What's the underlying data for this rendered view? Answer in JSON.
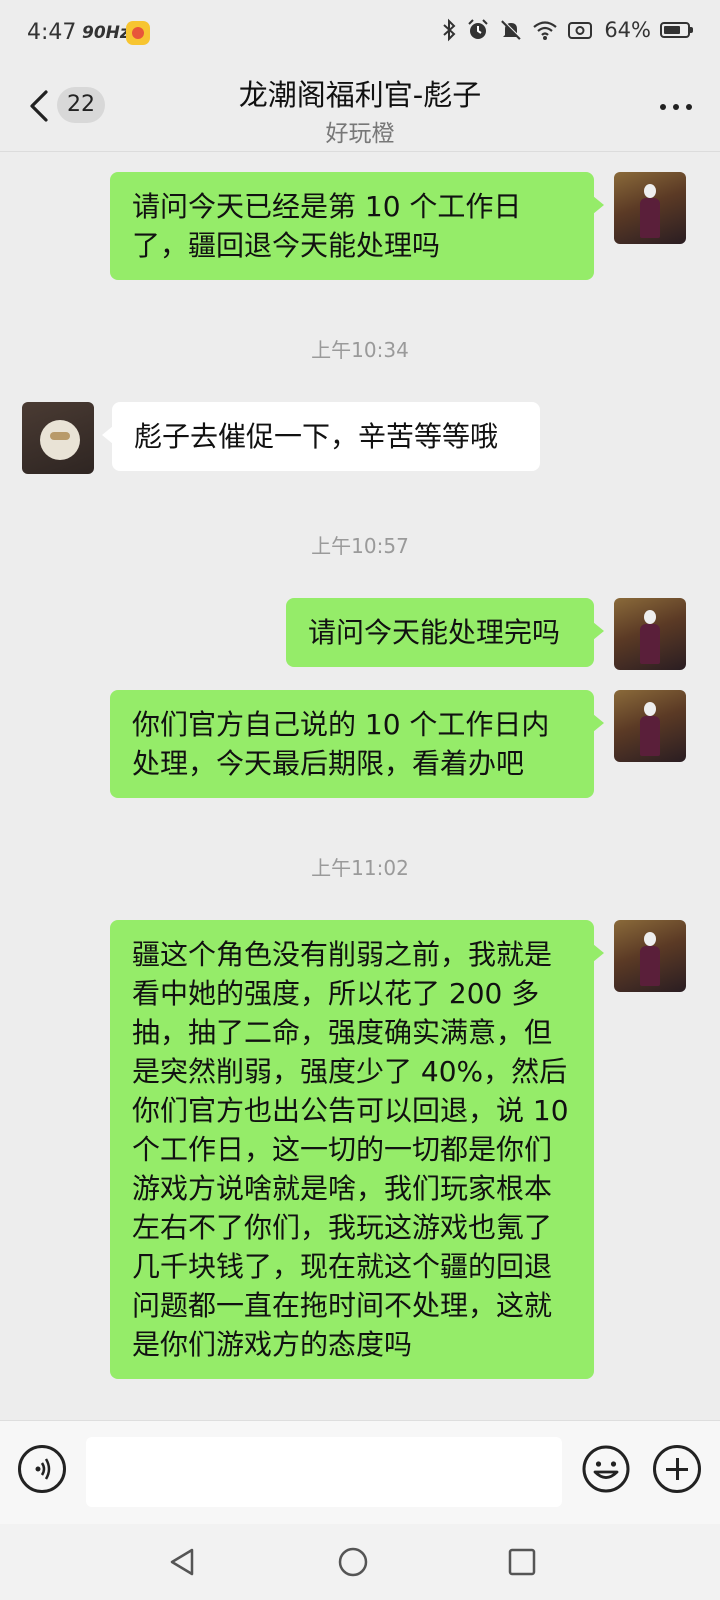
{
  "status_bar": {
    "time": "4:47",
    "refresh_rate": "90Hz",
    "battery": "64%",
    "icons": [
      "bluetooth-icon",
      "alarm-icon",
      "mute-icon",
      "wifi-icon",
      "screencast-icon",
      "battery-icon"
    ]
  },
  "header": {
    "back_badge": "22",
    "title": "龙潮阁福利官-彪子",
    "subtitle": "好玩橙"
  },
  "messages": [
    {
      "side": "out",
      "text": "请问今天已经是第 10 个工作日了，疆回退今天能处理吗"
    },
    {
      "timestamp": "上午10:34"
    },
    {
      "side": "in",
      "text": "彪子去催促一下，辛苦等等哦"
    },
    {
      "timestamp": "上午10:57"
    },
    {
      "side": "out",
      "text": "请问今天能处理完吗"
    },
    {
      "side": "out",
      "text": "你们官方自己说的 10 个工作日内处理，今天最后期限，看着办吧"
    },
    {
      "timestamp": "上午11:02"
    },
    {
      "side": "out",
      "text": "疆这个角色没有削弱之前，我就是看中她的强度，所以花了 200 多抽，抽了二命，强度确实满意，但是突然削弱，强度少了 40%，然后你们官方也出公告可以回退，说 10 个工作日，这一切的一切都是你们游戏方说啥就是啥，我们玩家根本左右不了你们，我玩这游戏也氪了几千块钱了，现在就这个疆的回退问题都一直在拖时间不处理，这就是你们游戏方的态度吗"
    }
  ],
  "colors": {
    "outgoing_bubble": "#95ec69",
    "incoming_bubble": "#ffffff",
    "background": "#ededed"
  }
}
